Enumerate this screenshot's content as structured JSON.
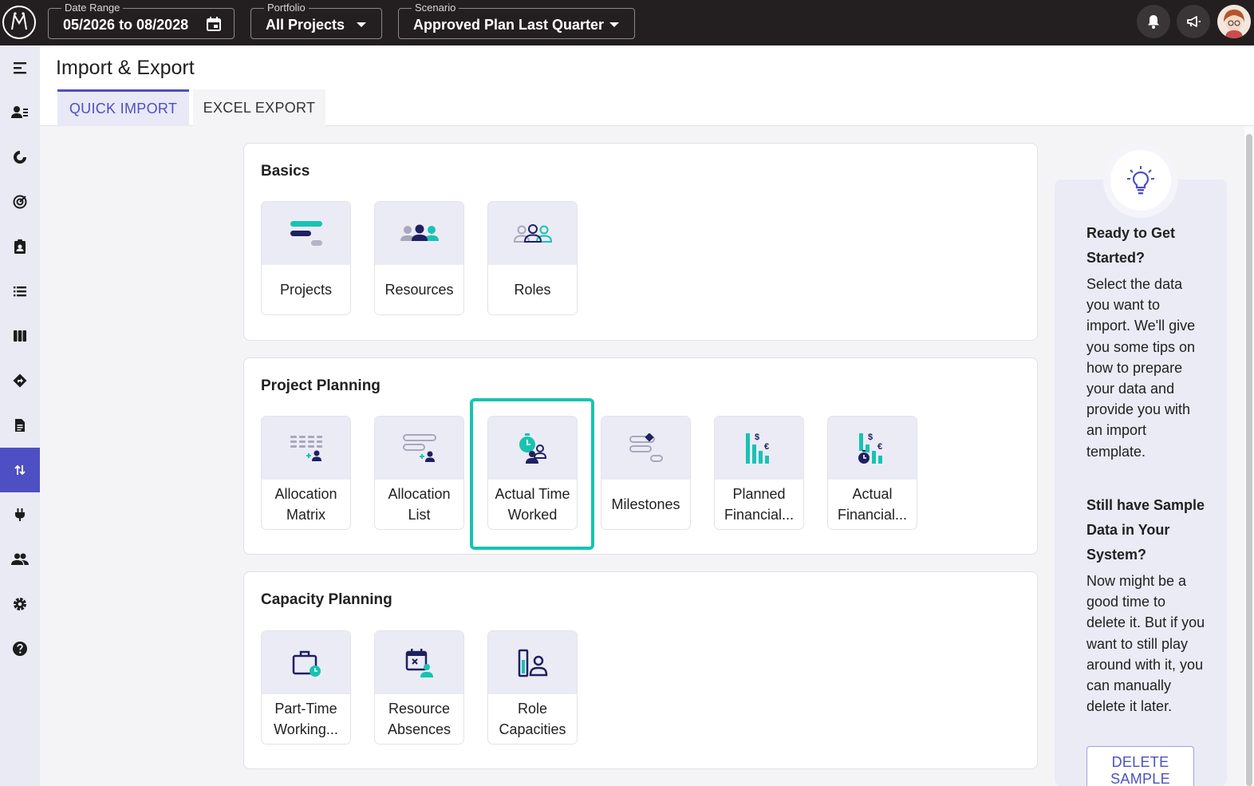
{
  "topbar": {
    "date_range": {
      "label": "Date Range",
      "value": "05/2026 to 08/2028"
    },
    "portfolio": {
      "label": "Portfolio",
      "value": "All Projects"
    },
    "scenario": {
      "label": "Scenario",
      "value": "Approved Plan Last Quarter"
    }
  },
  "sidebar": {
    "icons": [
      "menu-collapse-icon",
      "people-list-icon",
      "donut-chart-icon",
      "target-icon",
      "clipboard-person-icon",
      "list-icon",
      "columns-icon",
      "route-icon",
      "document-icon",
      "import-export-icon",
      "plug-icon",
      "group-icon",
      "gear-icon",
      "help-icon"
    ],
    "active_index": 9
  },
  "header": {
    "title": "Import & Export",
    "tabs": [
      {
        "label": "QUICK IMPORT",
        "active": true
      },
      {
        "label": "EXCEL EXPORT",
        "active": false
      }
    ]
  },
  "sections": {
    "basics": {
      "title": "Basics",
      "tiles": [
        "Projects",
        "Resources",
        "Roles"
      ]
    },
    "project_planning": {
      "title": "Project Planning",
      "tiles": [
        "Allocation Matrix",
        "Allocation List",
        "Actual Time Worked",
        "Milestones",
        "Planned Financial...",
        "Actual Financial..."
      ],
      "selected": "Actual Time Worked"
    },
    "capacity_planning": {
      "title": "Capacity Planning",
      "tiles": [
        "Part-Time Working...",
        "Resource Absences",
        "Role Capacities"
      ]
    }
  },
  "tips": {
    "heading1": "Ready to Get Started?",
    "text1": "Select the data you want to import. We'll give you some tips on how to prepare your data and provide you with an import template.",
    "heading2": "Still have Sample Data in Your System?",
    "text2": "Now might be a good time to delete it. But if you want to still play around with it, you can manually delete it later.",
    "button": "DELETE SAMPLE"
  },
  "colors": {
    "accent": "#4e4fc2",
    "teal": "#17c3b2",
    "navy": "#1f2060",
    "topbar": "#231f20"
  }
}
